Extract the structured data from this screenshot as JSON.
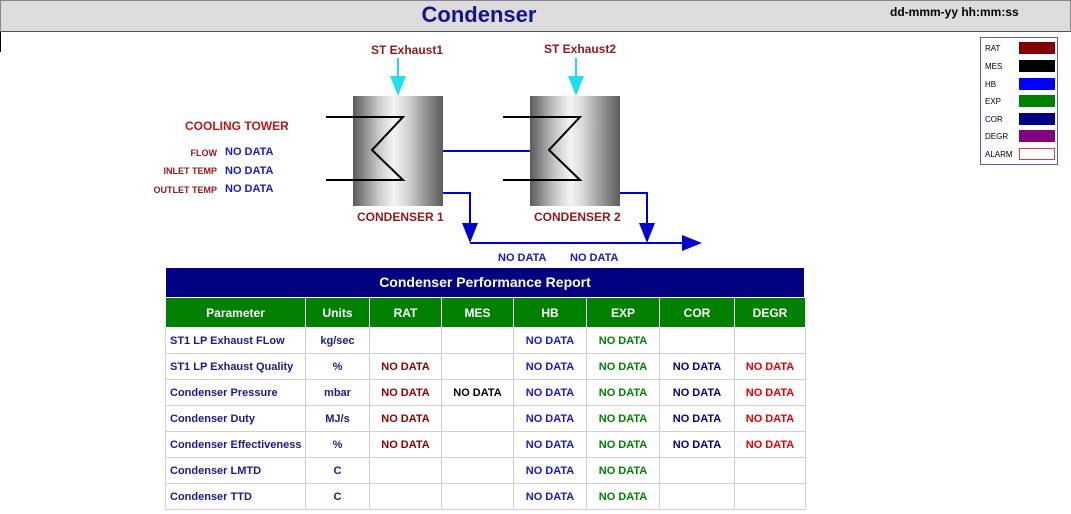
{
  "header": {
    "title": "Condenser",
    "datetime": "dd-mmm-yy hh:mm:ss"
  },
  "legend": [
    {
      "label": "RAT",
      "color": "#800000"
    },
    {
      "label": "MES",
      "color": "#000000"
    },
    {
      "label": "HB",
      "color": "#0000ff"
    },
    {
      "label": "EXP",
      "color": "#008000"
    },
    {
      "label": "COR",
      "color": "#000080"
    },
    {
      "label": "DEGR",
      "color": "#800080"
    },
    {
      "label": "ALARM",
      "color": "#ffffff"
    }
  ],
  "diagram": {
    "exhaust1": "ST Exhaust1",
    "exhaust2": "ST Exhaust2",
    "condenser1": "CONDENSER 1",
    "condenser2": "CONDENSER 2",
    "cooling_tower": {
      "title": "COOLING TOWER",
      "flow_label": "FLOW",
      "flow_value": "NO DATA",
      "inlet_label": "INLET TEMP",
      "inlet_value": "NO DATA",
      "outlet_label": "OUTLET TEMP",
      "outlet_value": "NO DATA"
    },
    "outlet_value_1": "NO DATA",
    "outlet_value_2": "NO DATA",
    "colors": {
      "pipe": "#0000cc",
      "exhaust_arrow": "#22ddee"
    }
  },
  "report": {
    "title": "Condenser Performance Report",
    "columns": [
      "Parameter",
      "Units",
      "RAT",
      "MES",
      "HB",
      "EXP",
      "COR",
      "DEGR"
    ],
    "rows": [
      {
        "param": "ST1 LP Exhaust FLow",
        "units": "kg/sec",
        "rat": "",
        "mes": "",
        "hb": "NO DATA",
        "exp": "NO DATA",
        "cor": "",
        "degr": ""
      },
      {
        "param": "ST1 LP Exhaust Quality",
        "units": "%",
        "rat": "NO DATA",
        "mes": "",
        "hb": "NO DATA",
        "exp": "NO DATA",
        "cor": "NO DATA",
        "degr": "NO DATA"
      },
      {
        "param": "Condenser Pressure",
        "units": "mbar",
        "rat": "NO DATA",
        "mes": "NO DATA",
        "hb": "NO DATA",
        "exp": "NO DATA",
        "cor": "NO DATA",
        "degr": "NO DATA"
      },
      {
        "param": "Condenser Duty",
        "units": "MJ/s",
        "rat": "NO DATA",
        "mes": "",
        "hb": "NO DATA",
        "exp": "NO DATA",
        "cor": "NO DATA",
        "degr": "NO DATA"
      },
      {
        "param": "Condenser Effectiveness",
        "units": "%",
        "rat": "NO DATA",
        "mes": "",
        "hb": "NO DATA",
        "exp": "NO DATA",
        "cor": "NO DATA",
        "degr": "NO DATA"
      },
      {
        "param": "Condenser LMTD",
        "units": "C",
        "rat": "",
        "mes": "",
        "hb": "NO DATA",
        "exp": "NO DATA",
        "cor": "",
        "degr": ""
      },
      {
        "param": "Condenser TTD",
        "units": "C",
        "rat": "",
        "mes": "",
        "hb": "NO DATA",
        "exp": "NO DATA",
        "cor": "",
        "degr": ""
      }
    ]
  }
}
